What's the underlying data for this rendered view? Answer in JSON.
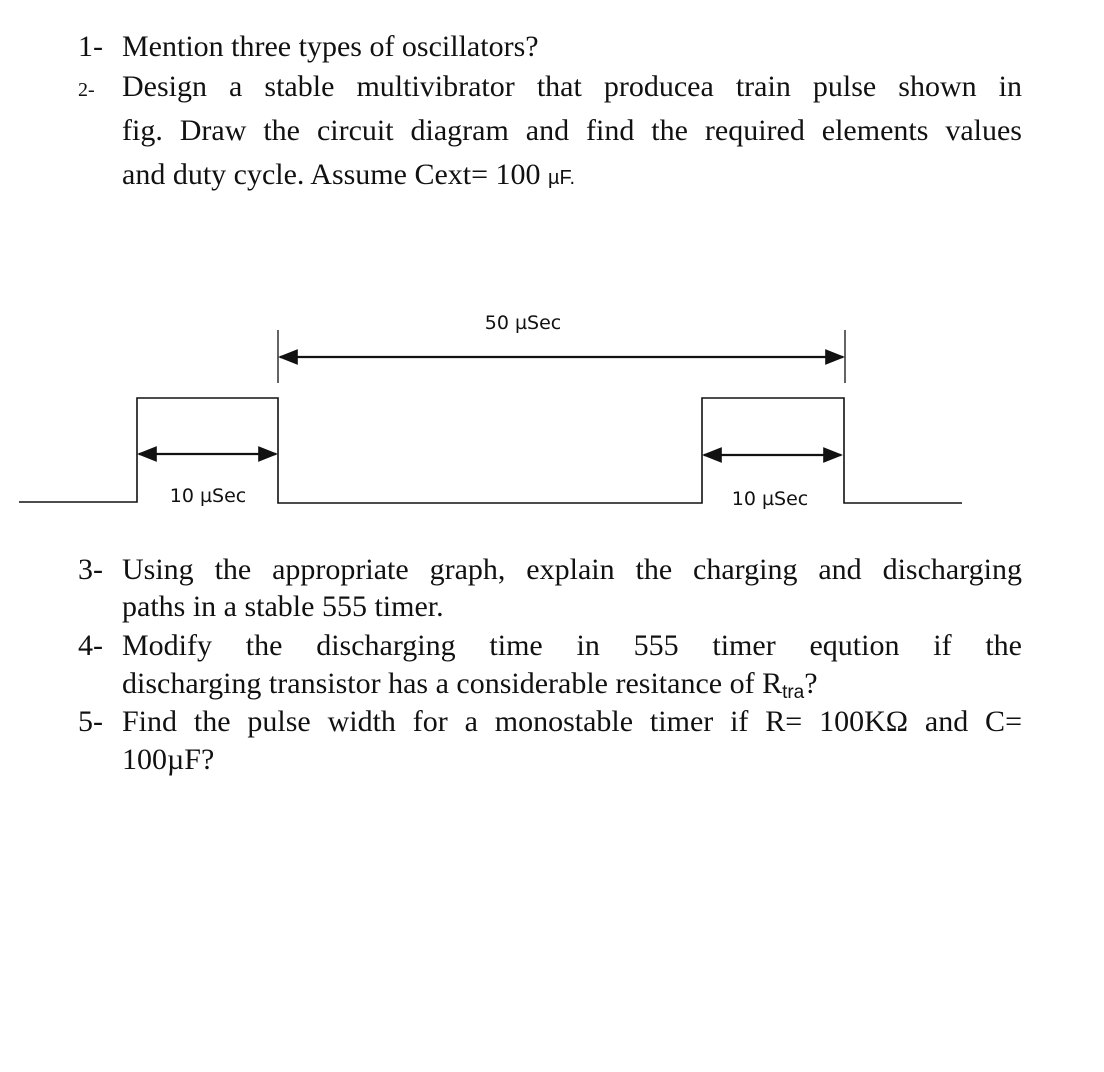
{
  "questions": [
    {
      "number": "1-",
      "lines": [
        "Mention three types of oscillators?"
      ]
    },
    {
      "number": "2-",
      "lines": [
        "Design a stable multivibrator that producea train pulse shown in",
        "fig. Draw the circuit diagram and find the required elements values",
        "and duty cycle. Assume Cext= 100 "
      ],
      "unit": "µF."
    },
    {
      "number": "3-",
      "lines": [
        "Using the appropriate graph, explain the charging and discharging",
        "paths in a stable 555 timer."
      ]
    },
    {
      "number": "4-",
      "lines": [
        "Modify the discharging time in 555 timer eqution if the",
        "discharging transistor has a considerable resitance of R"
      ],
      "subscript": "tra",
      "suffix": "?"
    },
    {
      "number": "5-",
      "lines": [
        "Find the pulse width for a monostable timer if R= 100KΩ and C=",
        "100µF?"
      ]
    }
  ],
  "figure": {
    "period_label": "50 µSec",
    "pulse1_label": "10 µSec",
    "pulse2_label": "10 µSec"
  }
}
